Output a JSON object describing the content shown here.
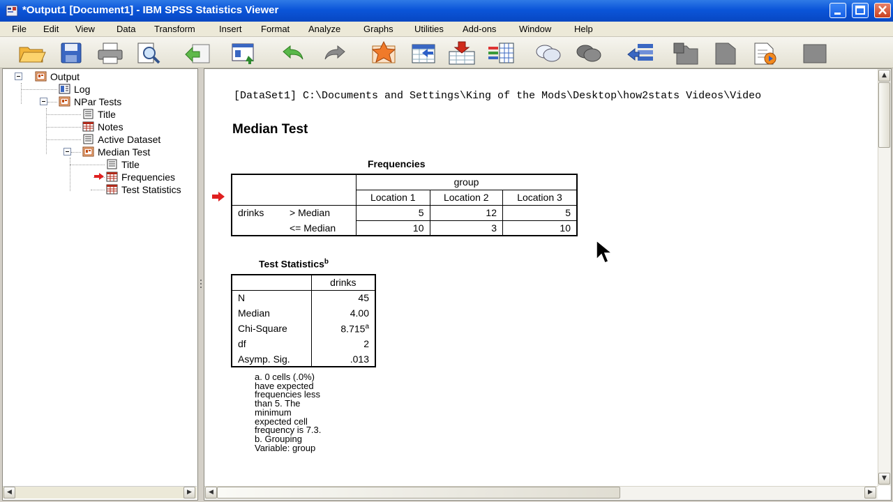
{
  "window": {
    "title": "*Output1 [Document1] - IBM SPSS Statistics Viewer"
  },
  "menu": [
    "File",
    "Edit",
    "View",
    "Data",
    "Transform",
    "Insert",
    "Format",
    "Analyze",
    "Graphs",
    "Utilities",
    "Add-ons",
    "Window",
    "Help"
  ],
  "toolbar": {
    "icons": [
      "open-icon",
      "save-icon",
      "print-icon",
      "print-preview-icon",
      "export-icon",
      "recall-dialog-icon",
      "undo-icon",
      "redo-icon",
      "goto-data-icon",
      "goto-case-icon",
      "insert-case-icon",
      "variables-icon",
      "show-all-icon",
      "hide-icon",
      "promote-icon",
      "collapse-icon",
      "expand-icon",
      "demote-icon",
      "run-script-icon",
      "designate-window-icon"
    ]
  },
  "outline": {
    "output": "Output",
    "log": "Log",
    "npar": "NPar Tests",
    "title1": "Title",
    "notes": "Notes",
    "active_dataset": "Active Dataset",
    "median_test": "Median Test",
    "title2": "Title",
    "frequencies": "Frequencies",
    "test_statistics": "Test Statistics"
  },
  "content": {
    "dataset_line": "[DataSet1] C:\\Documents and Settings\\King of the Mods\\Desktop\\how2stats Videos\\Video",
    "heading": "Median Test",
    "frequencies": {
      "title": "Frequencies",
      "group_header": "group",
      "columns": [
        "Location 1",
        "Location 2",
        "Location 3"
      ],
      "variable": "drinks",
      "rows": [
        {
          "label": "> Median",
          "values": [
            "5",
            "12",
            "5"
          ]
        },
        {
          "label": "<= Median",
          "values": [
            "10",
            "3",
            "10"
          ]
        }
      ]
    },
    "test_statistics": {
      "title": "Test Statistics",
      "title_sup": "b",
      "column": "drinks",
      "rows": [
        {
          "label": "N",
          "value": "45",
          "sup": ""
        },
        {
          "label": "Median",
          "value": "4.00",
          "sup": ""
        },
        {
          "label": "Chi-Square",
          "value": "8.715",
          "sup": "a"
        },
        {
          "label": "df",
          "value": "2",
          "sup": ""
        },
        {
          "label": "Asymp. Sig.",
          "value": ".013",
          "sup": ""
        }
      ],
      "footnotes": [
        "a. 0 cells (.0%)",
        "have expected",
        "frequencies less",
        "than 5. The",
        "minimum",
        "expected cell",
        "frequency is 7.3.",
        "b. Grouping",
        "Variable: group"
      ]
    }
  }
}
